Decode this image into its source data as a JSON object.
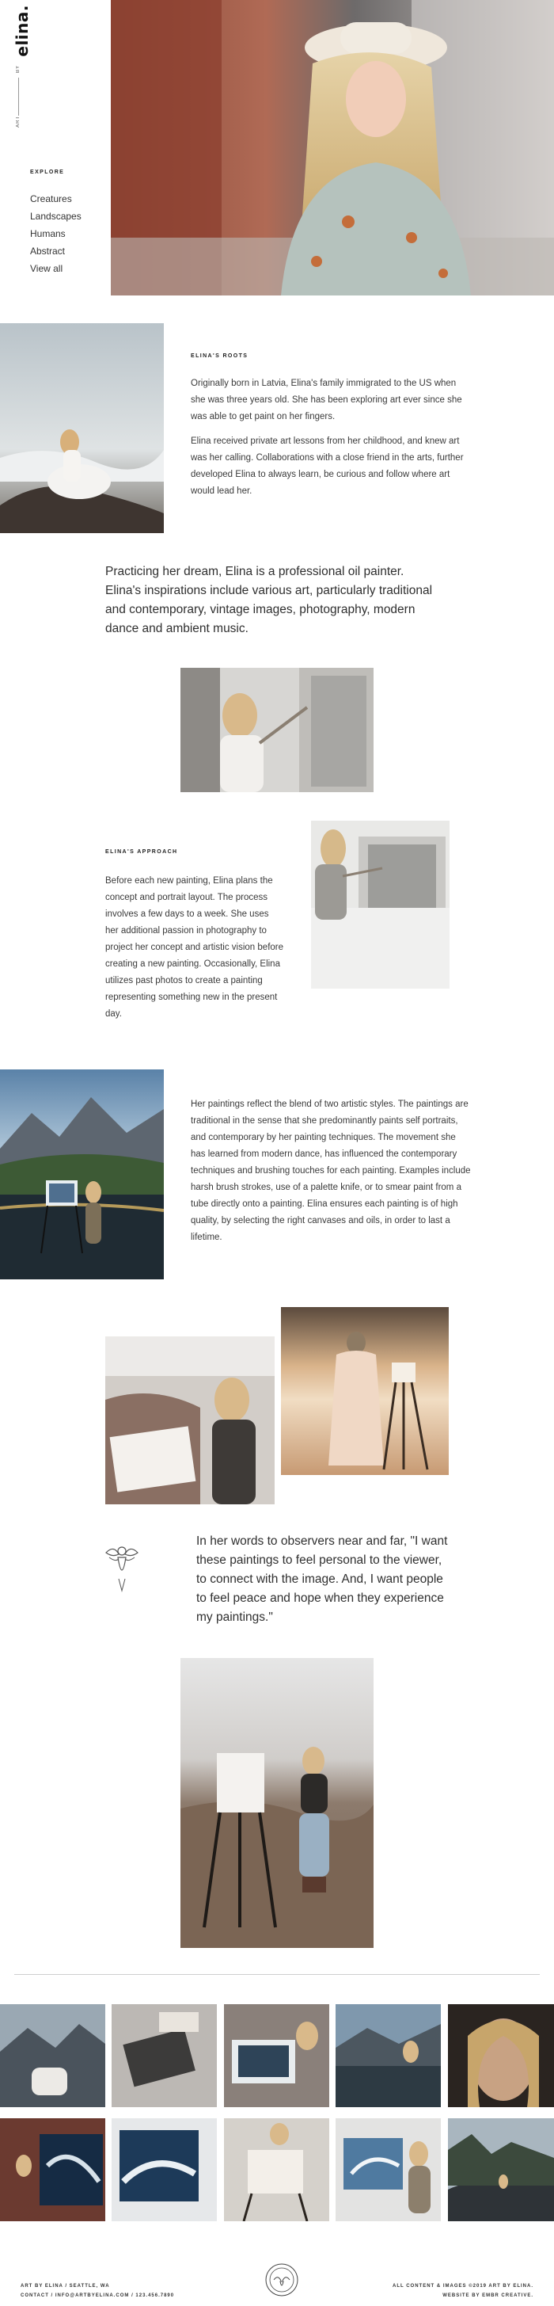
{
  "brand": {
    "name": "elina.",
    "by": "BY",
    "art": "ART"
  },
  "sidebar": {
    "explore_heading": "EXPLORE",
    "items": [
      {
        "label": "Creatures"
      },
      {
        "label": "Landscapes"
      },
      {
        "label": "Humans"
      },
      {
        "label": "Abstract"
      },
      {
        "label": "View all"
      }
    ]
  },
  "roots": {
    "heading": "ELINA'S ROOTS",
    "p1": "Originally born in Latvia, Elina's family immigrated to the US when she was three years old. She has been exploring art ever since she was able to get paint on her fingers.",
    "p2": "Elina received private art lessons from her childhood, and knew art was her calling. Collaborations with a close friend in the arts, further developed Elina to always learn, be curious and follow where art would lead her."
  },
  "lead_statement": "Practicing her dream, Elina is a professional oil painter. Elina's inspirations include various art, particularly traditional and contemporary, vintage images, photography, modern dance and ambient music.",
  "approach": {
    "heading": "ELINA'S APPROACH",
    "text": "Before each new painting, Elina plans the concept and portrait layout. The process involves a few days to a week. She uses her additional passion in photography to project her concept and artistic vision before creating a new painting. Occasionally, Elina utilizes past photos to create a painting representing something new in the present day."
  },
  "styles_text": "Her paintings reflect the blend of two artistic styles. The paintings are traditional in the sense that she predominantly paints self portraits, and contemporary by her painting techniques. The movement she has learned from modern dance, has influenced the contemporary techniques and brushing touches for each painting. Examples include harsh brush strokes, use of a palette knife, or to smear paint from a tube directly onto a painting. Elina ensures each painting is of high quality, by selecting the right canvases and oils, in order to last a lifetime.",
  "quote": "In her words to observers near and far, \"I want these paintings to feel personal to the viewer, to connect with the image. And, I want people to feel peace and hope when they experience my paintings.\"",
  "footer": {
    "left_line1": "ART BY ELINA / SEATTLE, WA",
    "left_line2": "CONTACT / INFO@ARTBYELINA.COM / 123.456.7890",
    "right_line1": "ALL CONTENT & IMAGES ©2019 ART BY ELINA.",
    "right_line2": "WEBSITE BY EMBR CREATIVE."
  },
  "colors": {
    "text": "#2b2b2b",
    "divider": "#cfcfcf",
    "accent": "#111111"
  },
  "icons": {
    "logo_bird": "bird-emblem-icon",
    "footer_seal": "seal-icon"
  }
}
